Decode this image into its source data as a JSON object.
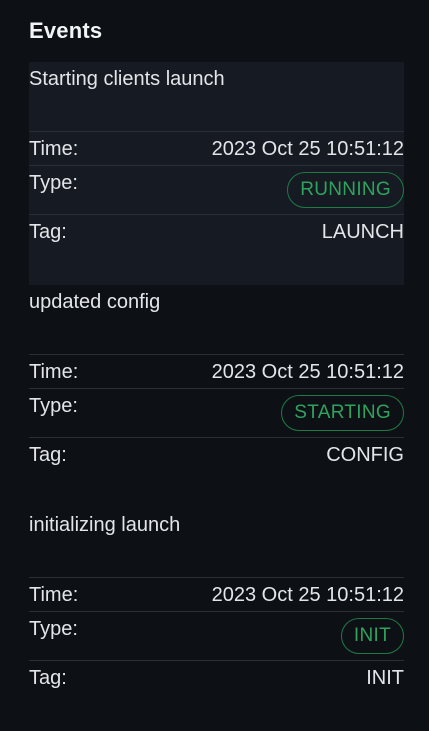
{
  "panel": {
    "title": "Events"
  },
  "events": [
    {
      "message": "Starting clients launch",
      "time_label": "Time:",
      "time": "2023 Oct 25 10:51:12",
      "type_label": "Type:",
      "type": "RUNNING",
      "tag_label": "Tag:",
      "tag": "LAUNCH"
    },
    {
      "message": "updated config",
      "time_label": "Time:",
      "time": "2023 Oct 25 10:51:12",
      "type_label": "Type:",
      "type": "STARTING",
      "tag_label": "Tag:",
      "tag": "CONFIG"
    },
    {
      "message": "initializing launch",
      "time_label": "Time:",
      "time": "2023 Oct 25 10:51:12",
      "type_label": "Type:",
      "type": "INIT",
      "tag_label": "Tag:",
      "tag": "INIT"
    }
  ],
  "colors": {
    "background": "#0d1015",
    "highlight_row": "#161a22",
    "badge_border": "#1f7a45",
    "badge_text": "#2fa35e"
  }
}
